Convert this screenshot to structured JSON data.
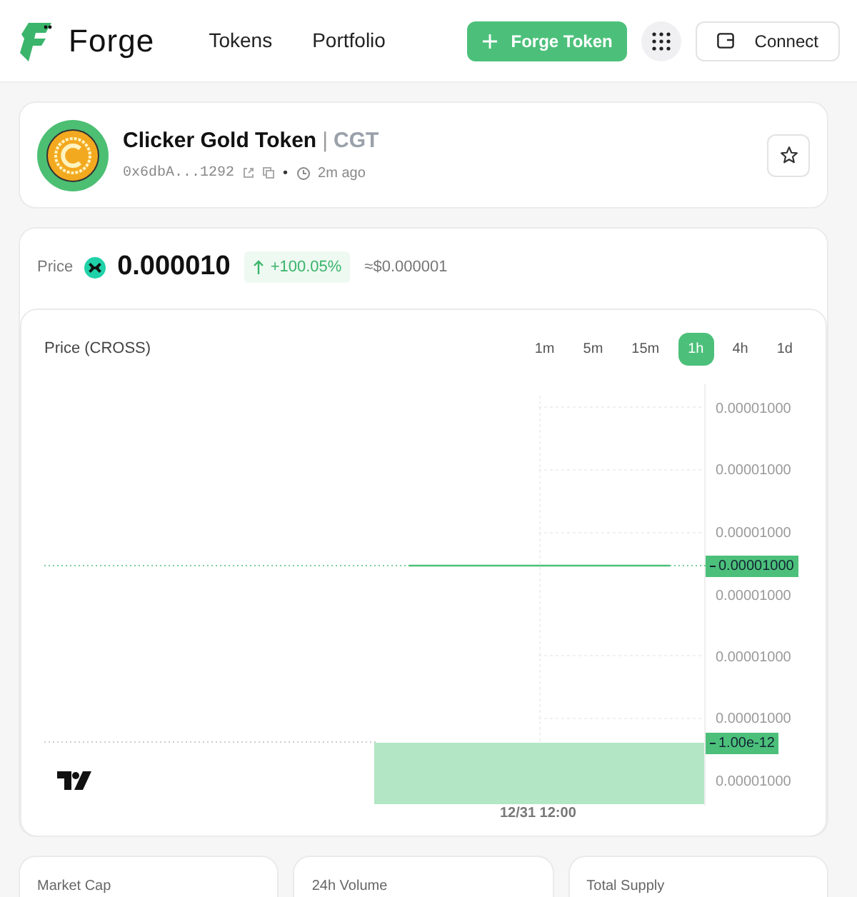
{
  "header": {
    "logo_text": "Forge",
    "nav": [
      {
        "label": "Tokens"
      },
      {
        "label": "Portfolio"
      }
    ],
    "create_button": "Forge Token",
    "connect_button": "Connect"
  },
  "token": {
    "name": "Clicker Gold Token",
    "separator": "|",
    "symbol": "CGT",
    "address": "0x6dbA...1292",
    "bullet": "•",
    "age": "2m ago"
  },
  "price": {
    "label": "Price",
    "value": "0.000010",
    "change": "+100.05%",
    "usd": "≈$0.000001"
  },
  "chart": {
    "title": "Price (CROSS)",
    "timeframes": [
      {
        "label": "1m",
        "selected": false
      },
      {
        "label": "5m",
        "selected": false
      },
      {
        "label": "15m",
        "selected": false
      },
      {
        "label": "1h",
        "selected": true
      },
      {
        "label": "4h",
        "selected": false
      },
      {
        "label": "1d",
        "selected": false
      }
    ],
    "y_labels": [
      "0.00001000",
      "0.00001000",
      "0.00001000",
      "0.00001000",
      "0.00001000",
      "0.00001000",
      "0.00001000"
    ],
    "price_tag": "0.00001000",
    "volume_tag": "1.00e-12",
    "x_label": "12/31 12:00"
  },
  "stats": [
    {
      "label": "Market Cap"
    },
    {
      "label": "24h Volume"
    },
    {
      "label": "Total Supply"
    }
  ]
}
